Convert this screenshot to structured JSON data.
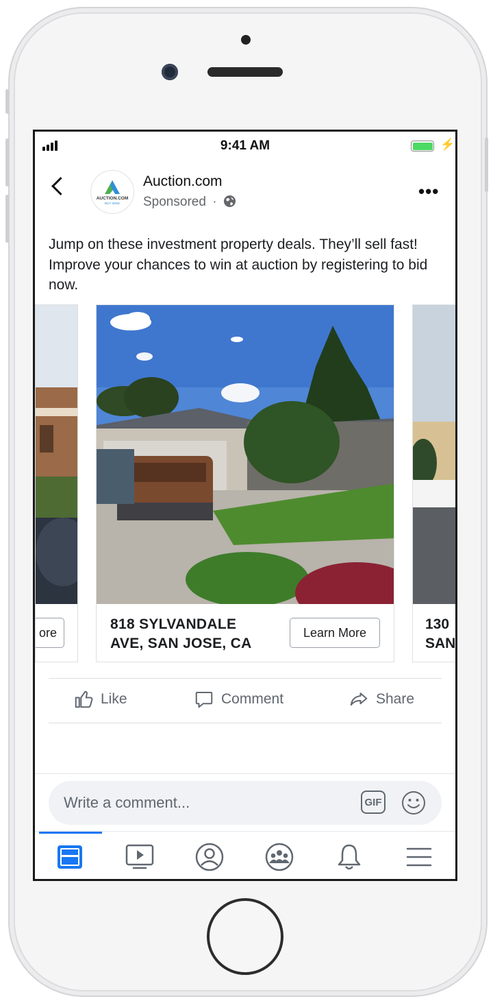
{
  "status_bar": {
    "time": "9:41 AM"
  },
  "post": {
    "page_name": "Auction.com",
    "sponsored_label": "Sponsored",
    "separator": "·",
    "avatar_brand": "AUCTION.COM",
    "avatar_tagline": "BUY WISE",
    "text": "Jump on these investment property deals. They’ll sell fast! Improve your chances to win at auction by registering to bid now."
  },
  "carousel": {
    "prev_card": {
      "cta_partial": "ore"
    },
    "current_card": {
      "title": "818 SYLVANDALE AVE, SAN JOSE, CA",
      "cta": "Learn More"
    },
    "next_card": {
      "title_partial_line1": "130",
      "title_partial_line2": "SAN"
    }
  },
  "actions": {
    "like": "Like",
    "comment": "Comment",
    "share": "Share"
  },
  "comment_input": {
    "placeholder": "Write a comment...",
    "gif_label": "GIF"
  },
  "tab_bar": {
    "tabs": [
      {
        "name": "news-feed",
        "active": true
      },
      {
        "name": "watch",
        "active": false
      },
      {
        "name": "profile",
        "active": false
      },
      {
        "name": "groups",
        "active": false
      },
      {
        "name": "notifications",
        "active": false
      },
      {
        "name": "menu",
        "active": false
      }
    ]
  },
  "colors": {
    "accent": "#1877f2",
    "text_secondary": "#606770",
    "battery": "#4cd964"
  }
}
